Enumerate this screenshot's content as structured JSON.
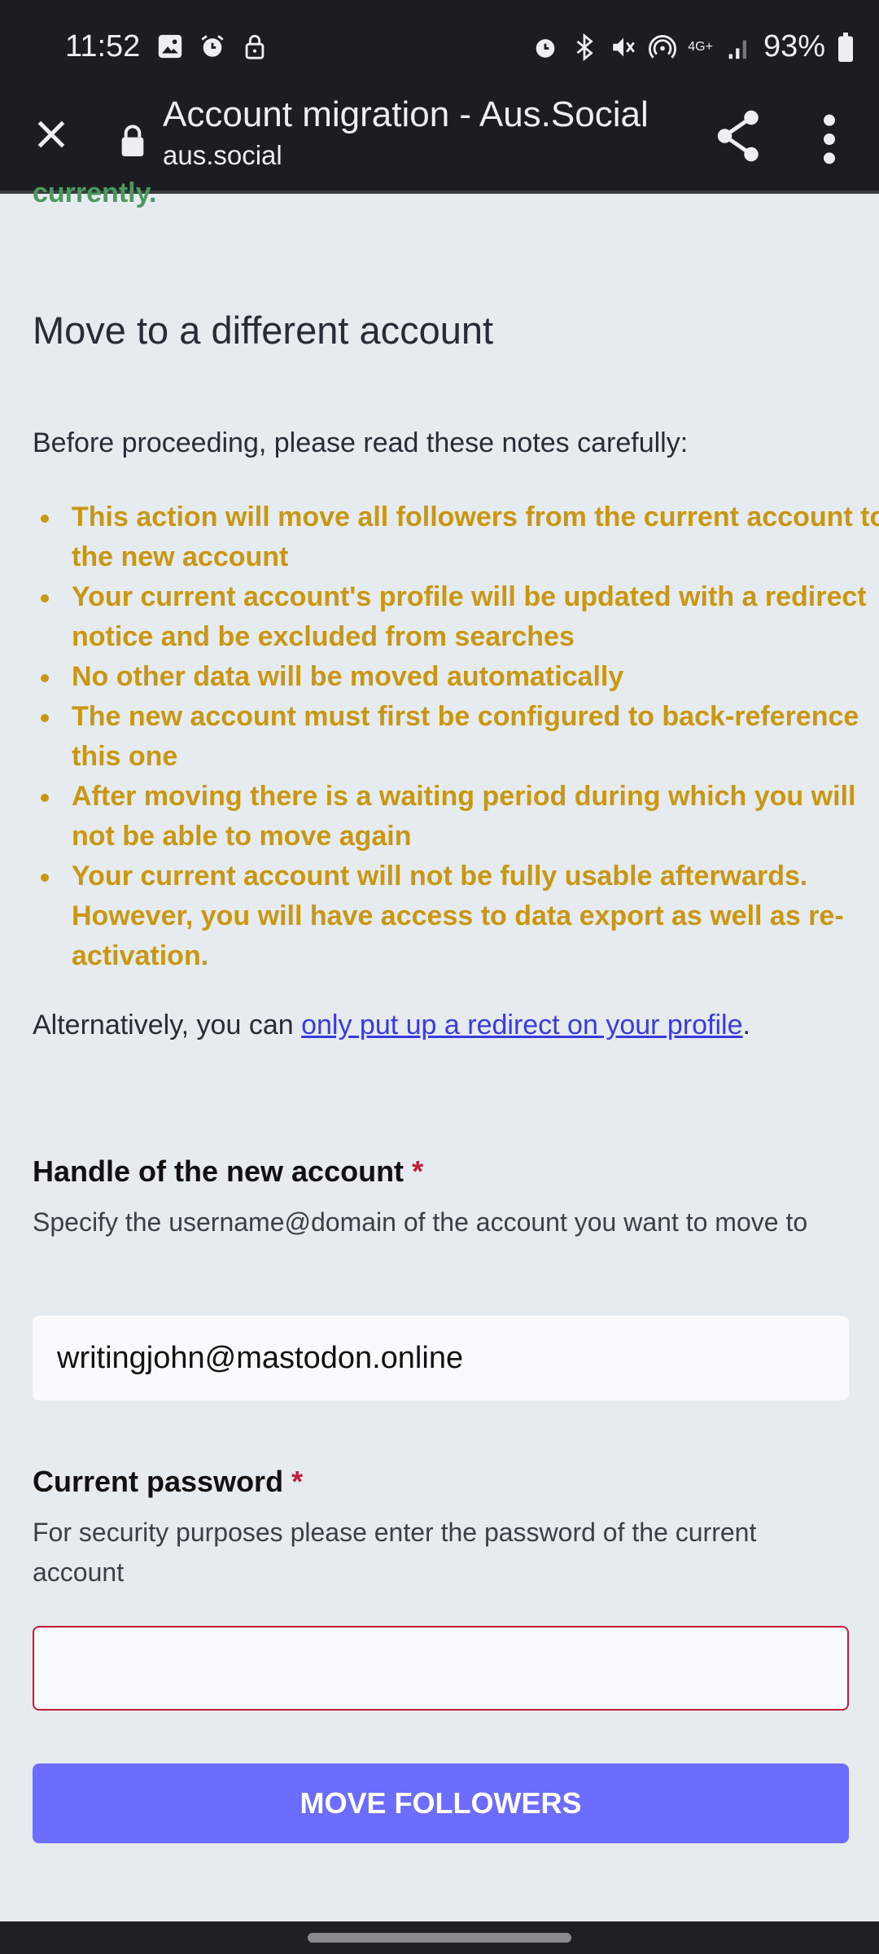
{
  "status_bar": {
    "time": "11:52",
    "battery": "93%",
    "network": "4G+",
    "left_icons": [
      "gallery-icon",
      "alarm-icon",
      "lock-icon"
    ],
    "right_icons": [
      "alarm-icon",
      "bluetooth-icon",
      "mute-icon",
      "hotspot-icon",
      "signal-icon",
      "battery-icon"
    ]
  },
  "browser": {
    "title": "Account migration - Aus.Social",
    "url": "aus.social"
  },
  "page": {
    "cut_text": "currently.",
    "heading": "Move to a different account",
    "intro": "Before proceeding, please read these notes carefully:",
    "notes": [
      "This action will move all followers from the current account to the new account",
      "Your current account's profile will be updated with a redirect notice and be excluded from searches",
      "No other data will be moved automatically",
      "The new account must first be configured to back-reference this one",
      "After moving there is a waiting period during which you will not be able to move again",
      "Your current account will not be fully usable afterwards. However, you will have access to data export as well as re-activation."
    ],
    "alt_prefix": "Alternatively, you can ",
    "alt_link": "only put up a redirect on your profile",
    "alt_suffix": ".",
    "handle_label": "Handle of the new account",
    "required_mark": "*",
    "handle_hint": "Specify the username@domain of the account you want to move to",
    "handle_value": "writingjohn@mastodon.online",
    "password_label": "Current password",
    "password_hint": "For security purposes please enter the password of the current account",
    "password_value": "",
    "submit_label": "MOVE FOLLOWERS"
  },
  "colors": {
    "warning": "#ca9712",
    "accent": "#6c6cff",
    "error": "#c21c3a",
    "link": "#3a3bdf",
    "success": "#4a9a5e"
  }
}
